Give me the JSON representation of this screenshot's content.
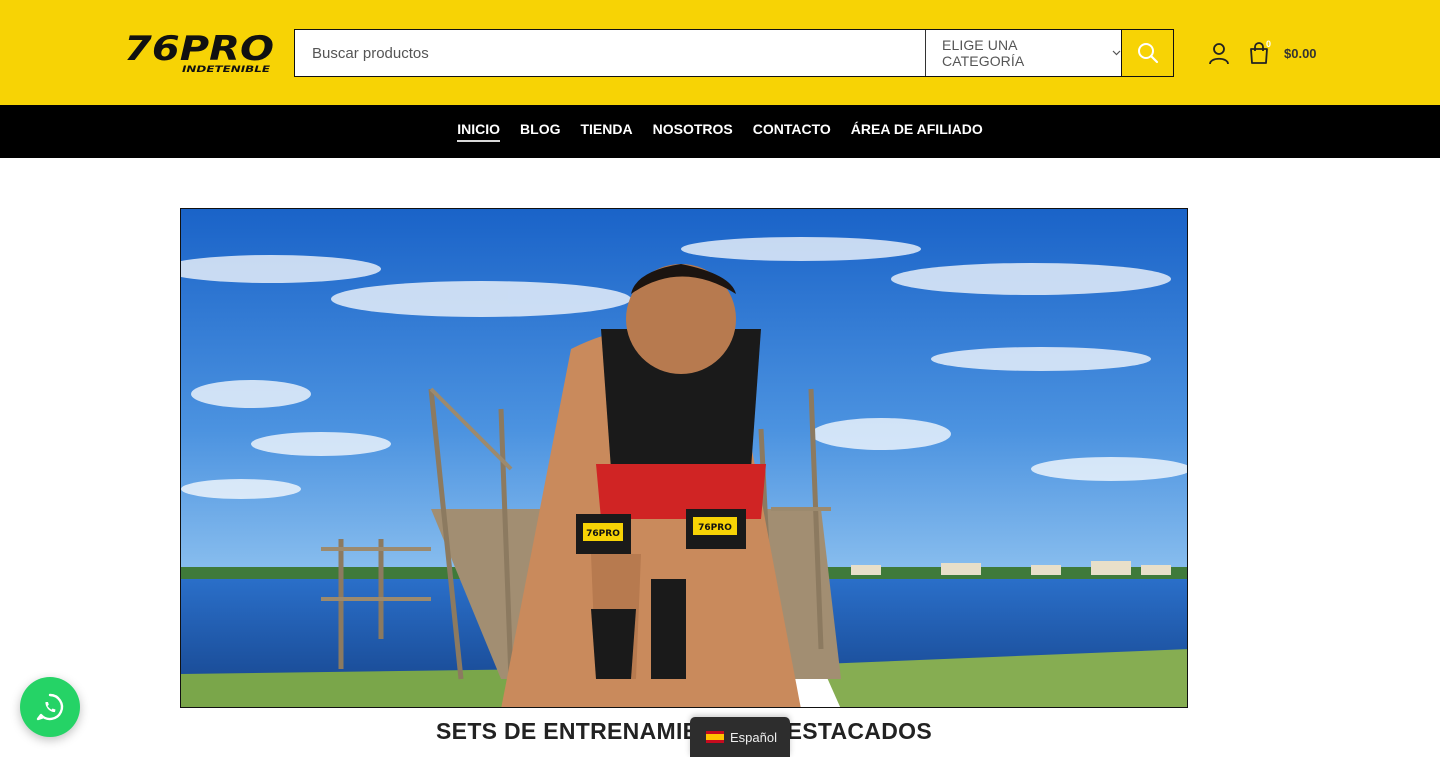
{
  "header": {
    "logo_text": "76PRO",
    "logo_sub": "INDETENIBLE",
    "search": {
      "placeholder": "Buscar productos",
      "category_label": "ELIGE UNA CATEGORÍA"
    },
    "cart": {
      "count": "0",
      "total": "$0.00"
    },
    "brand_color": "#f7d305"
  },
  "nav": {
    "items": [
      {
        "label": "INICIO",
        "active": true
      },
      {
        "label": "BLOG"
      },
      {
        "label": "TIENDA"
      },
      {
        "label": "NOSOTROS"
      },
      {
        "label": "CONTACTO"
      },
      {
        "label": "ÁREA DE AFILIADO"
      }
    ]
  },
  "main": {
    "section_title": "SETS DE ENTRENAMIENTOS DESTACADOS",
    "hero_band_label": "76PRO"
  },
  "language": {
    "label": "Español"
  },
  "icons": {
    "search": "search-icon",
    "account": "user-icon",
    "cart": "shopping-bag-icon",
    "whatsapp": "whatsapp-icon",
    "flag": "spain-flag-icon"
  }
}
